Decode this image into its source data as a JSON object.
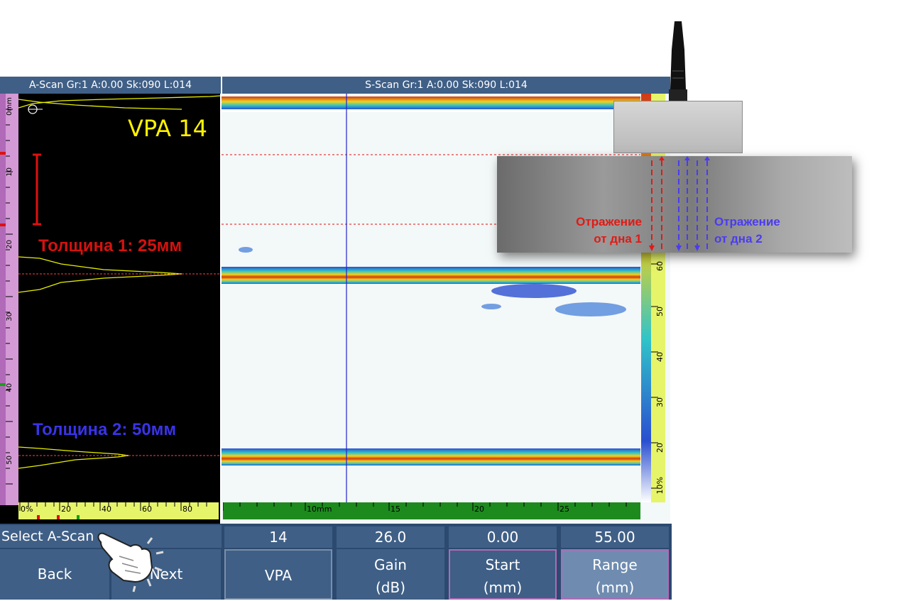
{
  "ascan": {
    "title": "A-Scan Gr:1 A:0.00 Sk:090 L:014",
    "vpa_overlay": "VPA 14",
    "thickness1": "Толщина 1: 25мм",
    "thickness2": "Толщина 2: 50мм",
    "depth_ticks": [
      "0mm",
      "10",
      "20",
      "30",
      "40",
      "50"
    ],
    "amp_ticks": [
      "0%",
      "20",
      "40",
      "60",
      "80"
    ]
  },
  "sscan": {
    "title": "S-Scan Gr:1 A:0.00 Sk:090 L:014",
    "bottom_ticks": [
      "10mm",
      "15",
      "20",
      "25"
    ],
    "right_ticks": [
      "60",
      "50",
      "40",
      "30",
      "20",
      "10%"
    ]
  },
  "diagram": {
    "reflection1_line1": "Отражение",
    "reflection1_line2": "от дна 1",
    "reflection2_line1": "Отражение",
    "reflection2_line2": "от дна 2"
  },
  "controls": {
    "hint": "Select A-Scan",
    "back_label": "Back",
    "next_label": "Next",
    "vpa_value": "14",
    "vpa_label": "VPA",
    "gain_value": "26.0",
    "gain_label1": "Gain",
    "gain_label2": "(dB)",
    "start_value": "0.00",
    "start_label1": "Start",
    "start_label2": "(mm)",
    "range_value": "55.00",
    "range_label1": "Range",
    "range_label2": "(mm)"
  },
  "colors": {
    "panel": "#3f5f86",
    "ascan_trace": "#e8f000",
    "thickness1": "#d4120f",
    "thickness2": "#3a33e8"
  }
}
